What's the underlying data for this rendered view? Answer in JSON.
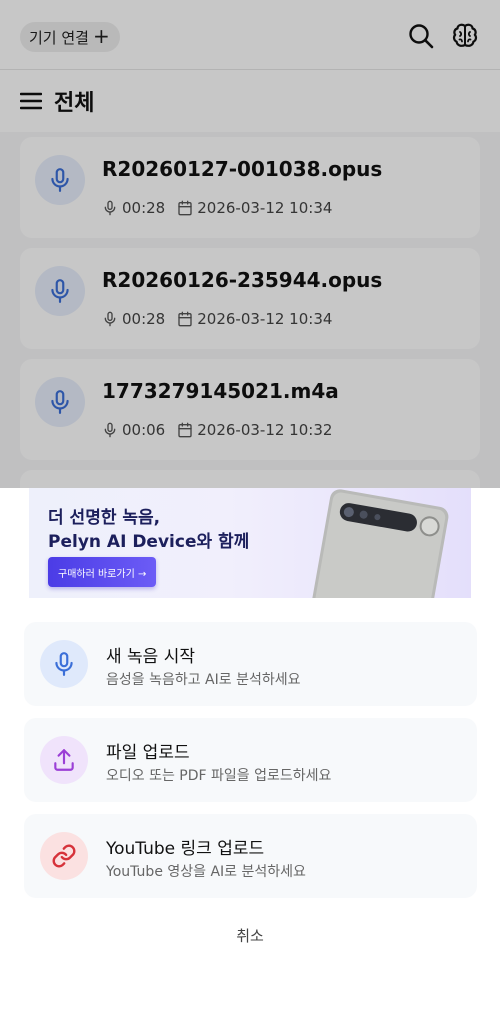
{
  "topbar": {
    "connect_label": "기기 연결",
    "connect_plus": "+",
    "icons": [
      "search-icon",
      "brain-icon"
    ]
  },
  "list": {
    "title": "전체",
    "recordings": [
      {
        "name": "R20260127-001038.opus",
        "duration": "00:28",
        "date": "2026-03-12 10:34"
      },
      {
        "name": "R20260126-235944.opus",
        "duration": "00:28",
        "date": "2026-03-12 10:34"
      },
      {
        "name": "1773279145021.m4a",
        "duration": "00:06",
        "date": "2026-03-12 10:32"
      }
    ]
  },
  "sheet": {
    "banner": {
      "headline_line1": "더 선명한 녹음,",
      "headline_line2": "Pelyn AI Device와 함께",
      "button_label": "구매하러 바로가기 →"
    },
    "options": [
      {
        "title": "새 녹음 시작",
        "subtitle": "음성을 녹음하고 AI로 분석하세요",
        "icon": "microphone-icon",
        "icon_bg": "#dfe9fb",
        "icon_color": "#3b6fd8"
      },
      {
        "title": "파일 업로드",
        "subtitle": "오디오 또는 PDF 파일을 업로드하세요",
        "icon": "upload-icon",
        "icon_bg": "#f0e3fb",
        "icon_color": "#9b3fd6"
      },
      {
        "title": "YouTube 링크 업로드",
        "subtitle": "YouTube 영상을 AI로 분석하세요",
        "icon": "link-icon",
        "icon_bg": "#fbe1e1",
        "icon_color": "#d6323a"
      }
    ],
    "cancel_label": "취소"
  },
  "colors": {
    "accent": "#4b3ce6",
    "banner_text": "#1c1f5c",
    "record_icon": "#3b6fd8"
  }
}
